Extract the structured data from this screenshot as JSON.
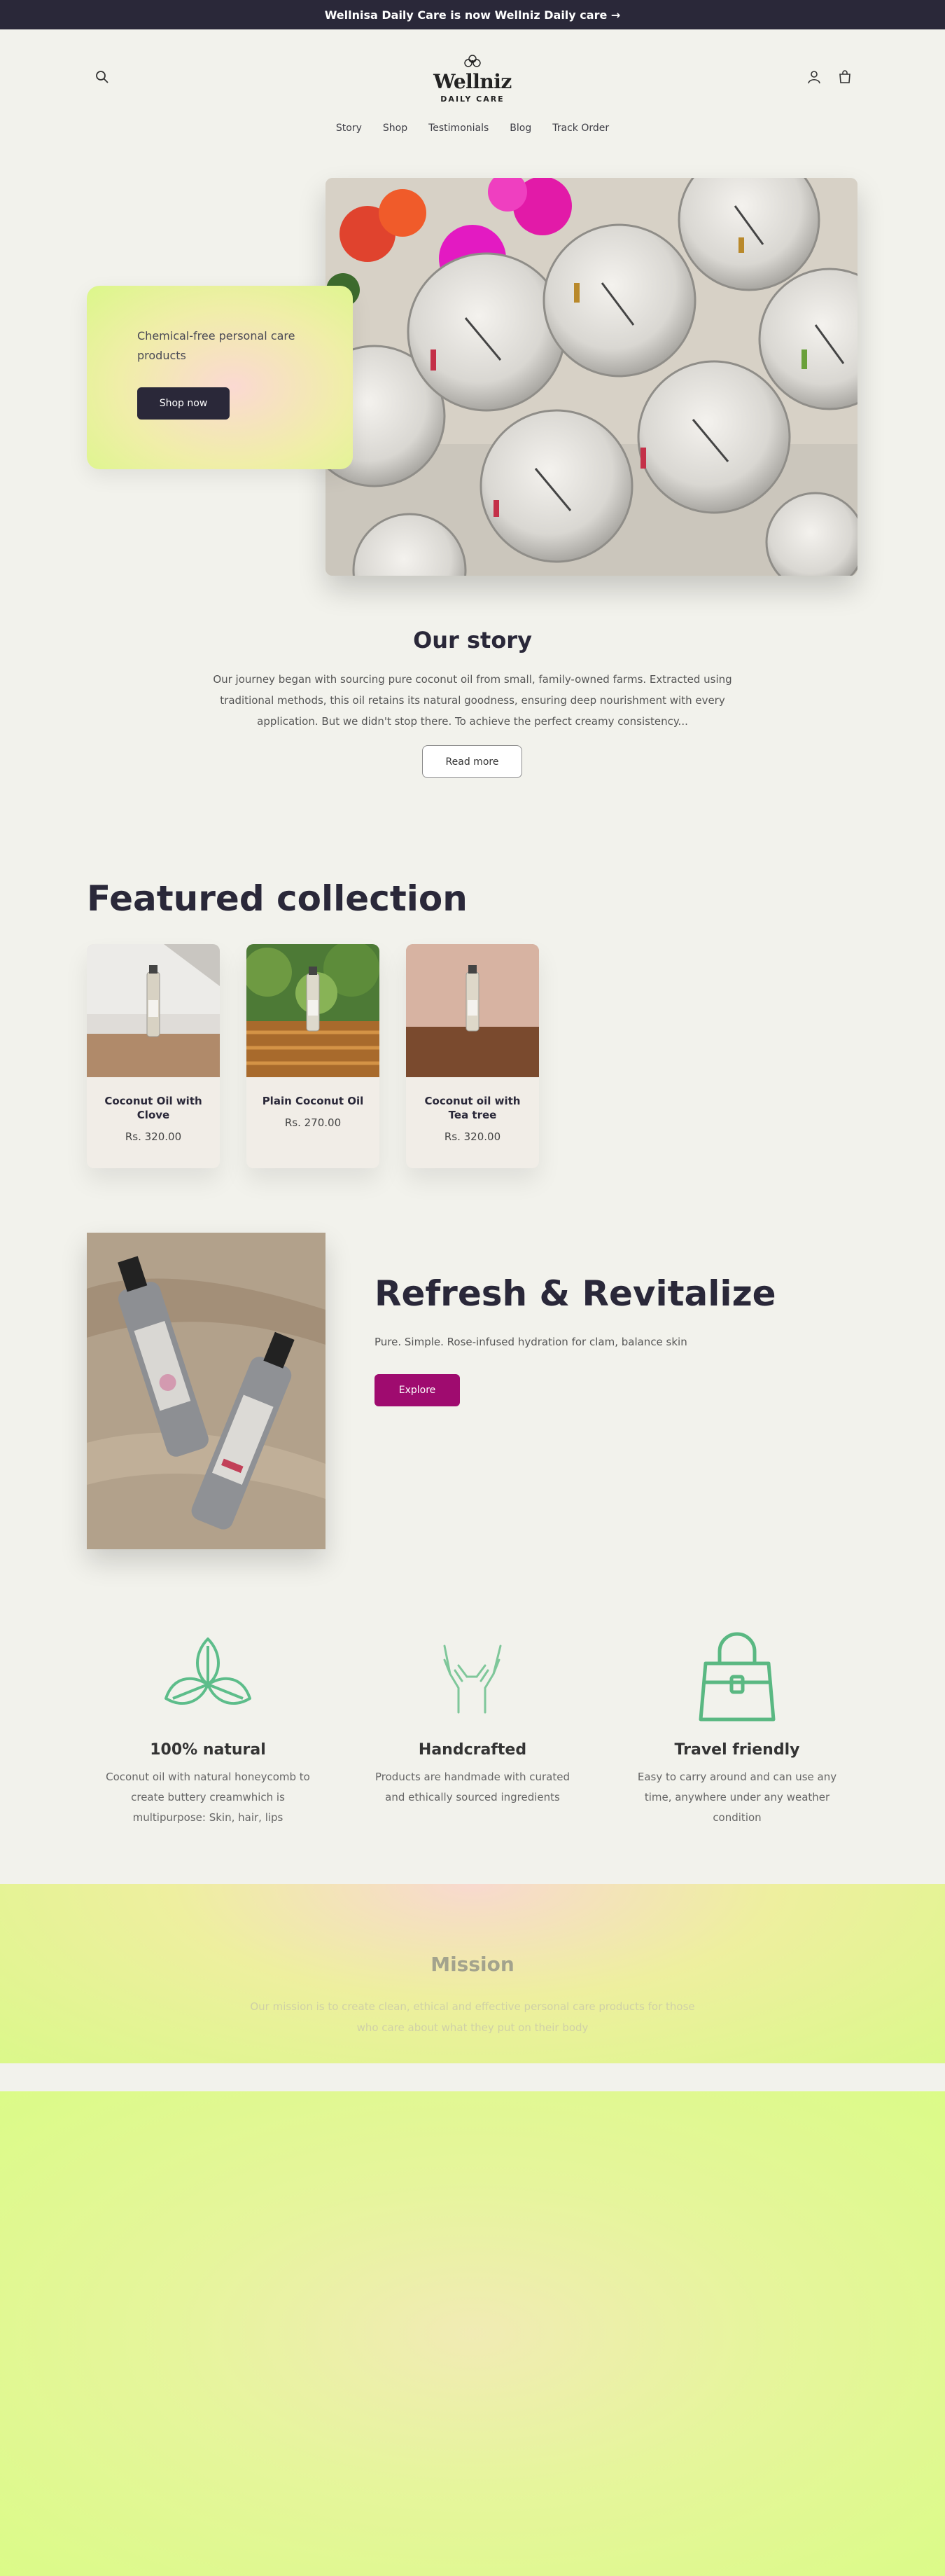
{
  "announcement": "Wellnisa Daily Care is now Wellniz Daily care →",
  "header": {
    "logo_text": "Wellniz",
    "logo_sub": "DAILY CARE",
    "nav": [
      "Story",
      "Shop",
      "Testimonials",
      "Blog",
      "Track Order"
    ],
    "icons": [
      "search-icon",
      "account-icon",
      "cart-icon"
    ]
  },
  "hero": {
    "text": "Chemical-free personal care products",
    "button": "Shop now"
  },
  "story": {
    "title": "Our story",
    "text": "Our journey began with sourcing pure coconut oil from small, family-owned farms. Extracted using traditional methods, this oil retains its natural goodness, ensuring deep nourishment with every application. But we didn't stop there. To achieve the perfect creamy consistency...",
    "button": "Read more"
  },
  "featured": {
    "title": "Featured collection",
    "products": [
      {
        "name": "Coconut Oil with Clove",
        "price": "Rs. 320.00"
      },
      {
        "name": "Plain Coconut Oil",
        "price": "Rs. 270.00"
      },
      {
        "name": "Coconut oil with Tea tree",
        "price": "Rs. 320.00"
      }
    ]
  },
  "refresh": {
    "title": "Refresh & Revitalize",
    "subtitle": "Pure. Simple. Rose-infused hydration for clam, balance skin",
    "button": "Explore"
  },
  "features": [
    {
      "icon": "leaves-icon",
      "title": "100% natural",
      "text": "Coconut oil with natural honeycomb to create buttery creamwhich is multipurpose: Skin, hair, lips"
    },
    {
      "icon": "hands-icon",
      "title": "Handcrafted",
      "text": "Products are handmade with curated and ethically sourced ingredients"
    },
    {
      "icon": "bag-icon",
      "title": "Travel friendly",
      "text": "Easy to carry around and can use any time, anywhere under any weather condition"
    }
  ],
  "mission": {
    "title": "Mission",
    "text": "Our mission is to create clean, ethical and effective personal care products for those who care about what they put on their body"
  },
  "colors": {
    "dark": "#2a2839",
    "accent": "#9f0b6f",
    "icon_green": "#5dbd8a",
    "background": "#f2f2ec"
  }
}
